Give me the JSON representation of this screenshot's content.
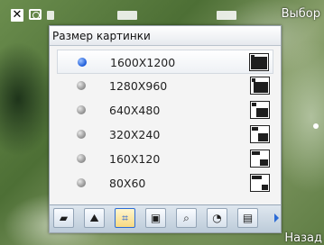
{
  "softkeys": {
    "right": "Выбор",
    "bottom": "Назад"
  },
  "menu": {
    "title": "Размер картинки",
    "selected_index": 0,
    "items": [
      {
        "label": "1600X1200",
        "icon": "resolution-1600-icon"
      },
      {
        "label": "1280X960",
        "icon": "resolution-1280-icon"
      },
      {
        "label": "640X480",
        "icon": "resolution-640-icon"
      },
      {
        "label": "320X240",
        "icon": "resolution-320-icon"
      },
      {
        "label": "160X120",
        "icon": "resolution-160-icon"
      },
      {
        "label": "80X60",
        "icon": "resolution-80-icon"
      }
    ]
  },
  "toolbar": {
    "active_index": 2,
    "tools": [
      {
        "name": "camera-mode-icon",
        "glyph": "▰"
      },
      {
        "name": "scene-icon",
        "glyph": "⛰"
      },
      {
        "name": "picture-size-icon",
        "glyph": "⌗"
      },
      {
        "name": "quality-icon",
        "glyph": "▣"
      },
      {
        "name": "zoom-icon",
        "glyph": "⌕"
      },
      {
        "name": "timer-icon",
        "glyph": "◔"
      },
      {
        "name": "more-icon",
        "glyph": "▤"
      }
    ]
  },
  "colors": {
    "accent": "#1a59d8",
    "menu_bg": "#f4f4f4"
  }
}
